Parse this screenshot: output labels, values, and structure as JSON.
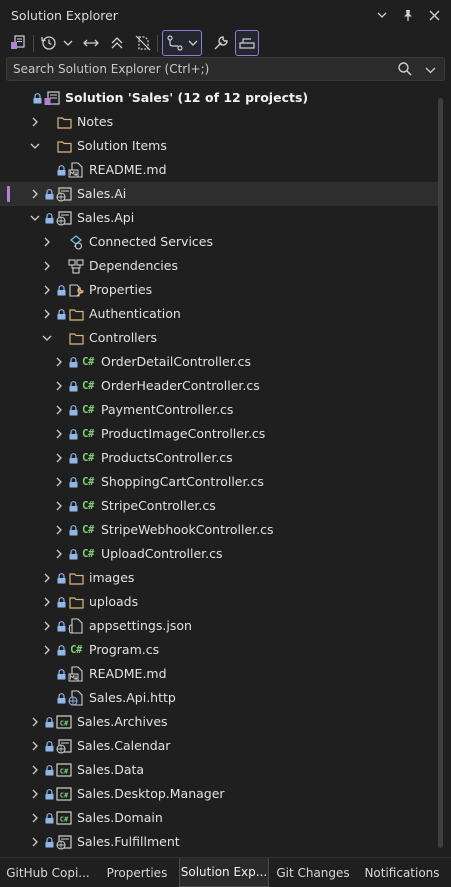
{
  "window": {
    "title": "Solution Explorer"
  },
  "search": {
    "placeholder": "Search Solution Explorer (Ctrl+;)"
  },
  "tree": [
    {
      "label": "Solution 'Sales' (12 of 12 projects)",
      "icon": "solution-icon",
      "lock": true,
      "bold": true
    },
    {
      "label": "Notes",
      "icon": "folder-icon",
      "expand": "collapsed"
    },
    {
      "label": "Solution Items",
      "icon": "folder-icon",
      "expand": "expanded"
    },
    {
      "label": "README.md",
      "icon": "markdown-file-icon",
      "lock": true
    },
    {
      "label": "Sales.Ai",
      "icon": "web-project-icon",
      "expand": "collapsed",
      "lock": true,
      "selected": true
    },
    {
      "label": "Sales.Api",
      "icon": "web-project-icon",
      "expand": "expanded",
      "lock": true
    },
    {
      "label": "Connected Services",
      "icon": "connected-services-icon",
      "expand": "collapsed"
    },
    {
      "label": "Dependencies",
      "icon": "dependencies-icon",
      "expand": "collapsed"
    },
    {
      "label": "Properties",
      "icon": "properties-icon",
      "expand": "collapsed",
      "lock": true
    },
    {
      "label": "Authentication",
      "icon": "folder-icon",
      "expand": "collapsed",
      "lock": true
    },
    {
      "label": "Controllers",
      "icon": "folder-icon",
      "expand": "expanded"
    },
    {
      "label": "OrderDetailController.cs",
      "icon": "csharp-file-icon",
      "expand": "collapsed",
      "lock": true
    },
    {
      "label": "OrderHeaderController.cs",
      "icon": "csharp-file-icon",
      "expand": "collapsed",
      "lock": true
    },
    {
      "label": "PaymentController.cs",
      "icon": "csharp-file-icon",
      "expand": "collapsed",
      "lock": true
    },
    {
      "label": "ProductImageController.cs",
      "icon": "csharp-file-icon",
      "expand": "collapsed",
      "lock": true
    },
    {
      "label": "ProductsController.cs",
      "icon": "csharp-file-icon",
      "expand": "collapsed",
      "lock": true
    },
    {
      "label": "ShoppingCartController.cs",
      "icon": "csharp-file-icon",
      "expand": "collapsed",
      "lock": true
    },
    {
      "label": "StripeController.cs",
      "icon": "csharp-file-icon",
      "expand": "collapsed",
      "lock": true
    },
    {
      "label": "StripeWebhookController.cs",
      "icon": "csharp-file-icon",
      "expand": "collapsed",
      "lock": true
    },
    {
      "label": "UploadController.cs",
      "icon": "csharp-file-icon",
      "expand": "collapsed",
      "lock": true
    },
    {
      "label": "images",
      "icon": "folder-icon",
      "expand": "collapsed",
      "lock": true
    },
    {
      "label": "uploads",
      "icon": "folder-icon",
      "expand": "collapsed",
      "lock": true
    },
    {
      "label": "appsettings.json",
      "icon": "json-file-icon",
      "expand": "collapsed",
      "lock": true
    },
    {
      "label": "Program.cs",
      "icon": "csharp-file-icon",
      "expand": "collapsed",
      "lock": true
    },
    {
      "label": "README.md",
      "icon": "markdown-file-icon",
      "lock": true
    },
    {
      "label": "Sales.Api.http",
      "icon": "http-file-icon",
      "lock": true
    },
    {
      "label": "Sales.Archives",
      "icon": "csharp-project-icon",
      "expand": "collapsed",
      "lock": true
    },
    {
      "label": "Sales.Calendar",
      "icon": "web-project-icon",
      "expand": "collapsed",
      "lock": true
    },
    {
      "label": "Sales.Data",
      "icon": "csharp-project-icon",
      "expand": "collapsed",
      "lock": true
    },
    {
      "label": "Sales.Desktop.Manager",
      "icon": "csharp-project-icon",
      "expand": "collapsed",
      "lock": true
    },
    {
      "label": "Sales.Domain",
      "icon": "csharp-project-icon",
      "expand": "collapsed",
      "lock": true
    },
    {
      "label": "Sales.Fulfillment",
      "icon": "web-project-icon",
      "expand": "collapsed",
      "lock": true
    }
  ],
  "csharp_glyph": "C#",
  "tabs": [
    {
      "label": "GitHub Copi..."
    },
    {
      "label": "Properties"
    },
    {
      "label": "Solution Exp..."
    },
    {
      "label": "Git Changes"
    },
    {
      "label": "Notifications"
    }
  ],
  "colors": {
    "background": "#1f1f1f",
    "accent": "#8a7fd8",
    "csharp": "#7fd07f",
    "folder": "#dcb67a"
  }
}
